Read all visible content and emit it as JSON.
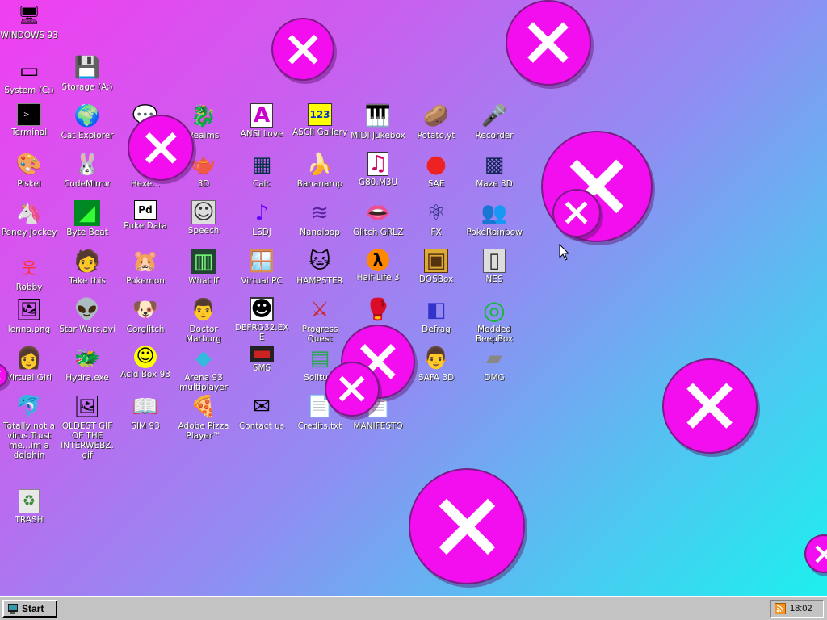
{
  "desktop": {
    "icons": [
      {
        "id": "windows93",
        "label": "WINDOWS 93",
        "glyph": "🖥"
      },
      {
        "id": "system-c",
        "label": "System (C:)",
        "glyph": "▭"
      },
      {
        "id": "storage-a",
        "label": "Storage (A:)",
        "glyph": "💾"
      },
      {
        "id": "terminal",
        "label": "Terminal",
        "glyph": ">_"
      },
      {
        "id": "cat-explorer",
        "label": "Cat Explorer",
        "glyph": "🌍"
      },
      {
        "id": "chat",
        "label": "",
        "glyph": "💬"
      },
      {
        "id": "realms",
        "label": "Realms",
        "glyph": "🐉"
      },
      {
        "id": "ansi-love",
        "label": "ANSI Love",
        "glyph": "A"
      },
      {
        "id": "ascii-gallery",
        "label": "ASCII Gallery",
        "glyph": "123"
      },
      {
        "id": "midi-jukebox",
        "label": "MIDI Jukebox",
        "glyph": "🎹"
      },
      {
        "id": "potato-yt",
        "label": "Potato.yt",
        "glyph": "🥔"
      },
      {
        "id": "recorder",
        "label": "Recorder",
        "glyph": "🎤"
      },
      {
        "id": "piskel",
        "label": "Piskel",
        "glyph": "🎨"
      },
      {
        "id": "codemirror",
        "label": "CodeMirror",
        "glyph": "🐰"
      },
      {
        "id": "hexed",
        "label": "Hexe...",
        "glyph": "#"
      },
      {
        "id": "3d",
        "label": "3D",
        "glyph": "🫖"
      },
      {
        "id": "calc",
        "label": "Calc",
        "glyph": "▦"
      },
      {
        "id": "bananamp",
        "label": "Bananamp",
        "glyph": "🍌"
      },
      {
        "id": "g80m3u",
        "label": "G80.M3U",
        "glyph": "♫"
      },
      {
        "id": "sae",
        "label": "SAE",
        "glyph": "●"
      },
      {
        "id": "maze-3d",
        "label": "Maze 3D",
        "glyph": "▩"
      },
      {
        "id": "poney-jockey",
        "label": "Poney Jockey",
        "glyph": "🦄"
      },
      {
        "id": "byte-beat",
        "label": "Byte Beat",
        "glyph": "◢"
      },
      {
        "id": "puke-data",
        "label": "Puke Data",
        "glyph": "Pd"
      },
      {
        "id": "speech",
        "label": "Speech",
        "glyph": "☺"
      },
      {
        "id": "lsdj",
        "label": "LSDJ",
        "glyph": "♪"
      },
      {
        "id": "nanoloop",
        "label": "Nanoloop",
        "glyph": "≋"
      },
      {
        "id": "glitch-grlz",
        "label": "Glitch GRLZ",
        "glyph": "👄"
      },
      {
        "id": "fx",
        "label": "FX",
        "glyph": "⚛"
      },
      {
        "id": "pokerainbow",
        "label": "PokéRainbow",
        "glyph": "👥"
      },
      {
        "id": "robby",
        "label": "Robby",
        "glyph": "웃"
      },
      {
        "id": "take-this",
        "label": "Take this",
        "glyph": "🧑"
      },
      {
        "id": "pokemon",
        "label": "Pokemon",
        "glyph": "🐹"
      },
      {
        "id": "what-if",
        "label": "What If",
        "glyph": "▥"
      },
      {
        "id": "virtual-pc",
        "label": "Virtual PC",
        "glyph": "🪟"
      },
      {
        "id": "hampster",
        "label": "HAMPSTER",
        "glyph": "🐱"
      },
      {
        "id": "half-life-3",
        "label": "Half-Life 3",
        "glyph": "λ"
      },
      {
        "id": "dosbox",
        "label": "DOSBox",
        "glyph": "▣"
      },
      {
        "id": "nes",
        "label": "NES",
        "glyph": "▯"
      },
      {
        "id": "lenna-png",
        "label": "lenna.png",
        "glyph": "🖼"
      },
      {
        "id": "star-wars",
        "label": "Star Wars.avi",
        "glyph": "👽"
      },
      {
        "id": "corglitch",
        "label": "Corglitch",
        "glyph": "🐶"
      },
      {
        "id": "doctor-marburg",
        "label": "Doctor Marburg",
        "glyph": "👨"
      },
      {
        "id": "defrag32",
        "label": "DEFRG32.EXE",
        "glyph": "☻"
      },
      {
        "id": "progress-quest",
        "label": "Progress Quest",
        "glyph": "⚔"
      },
      {
        "id": "street-fighter",
        "label": "",
        "glyph": "🥊"
      },
      {
        "id": "defrag",
        "label": "Defrag",
        "glyph": "◧"
      },
      {
        "id": "modded-beepbox",
        "label": "Modded BeepBox",
        "glyph": "◎"
      },
      {
        "id": "virtual-girl",
        "label": "Virtual Girl",
        "glyph": "👩"
      },
      {
        "id": "hydra-exe",
        "label": "Hydra.exe",
        "glyph": "🐲"
      },
      {
        "id": "acid-box-93",
        "label": "Acid Box 93",
        "glyph": "☺"
      },
      {
        "id": "arena-93",
        "label": "Arena 93 multiplayer",
        "glyph": "◆"
      },
      {
        "id": "sms",
        "label": "SMS",
        "glyph": "▬"
      },
      {
        "id": "solitude",
        "label": "Solitu...",
        "glyph": "▤"
      },
      {
        "id": "safa-3d",
        "label": "SAFA 3D",
        "glyph": "👨"
      },
      {
        "id": "dmg",
        "label": "DMG",
        "glyph": "▰"
      },
      {
        "id": "dolphin",
        "label": "Totally not a virus.Trust me...im a dolphin",
        "glyph": "🐬"
      },
      {
        "id": "oldest-gif",
        "label": "OLDEST GIF OF THE INTERWEBZ.gif",
        "glyph": "🖼"
      },
      {
        "id": "sim-93",
        "label": "SIM 93",
        "glyph": "📖"
      },
      {
        "id": "adobe-pizza",
        "label": "Adobe Pizza Player™",
        "glyph": "🍕"
      },
      {
        "id": "contact-us",
        "label": "Contact us",
        "glyph": "✉"
      },
      {
        "id": "credits-txt",
        "label": "Credits.txt",
        "glyph": "📄"
      },
      {
        "id": "manifesto",
        "label": "MANIFESTO",
        "glyph": "📄"
      },
      {
        "id": "trash",
        "label": "TRASH",
        "glyph": "♻"
      }
    ]
  },
  "taskbar": {
    "start_label": "Start",
    "clock": "18:02"
  },
  "colors": {
    "accent_pink": "#f30ef0",
    "taskbar_gray": "#c3c3c3"
  }
}
